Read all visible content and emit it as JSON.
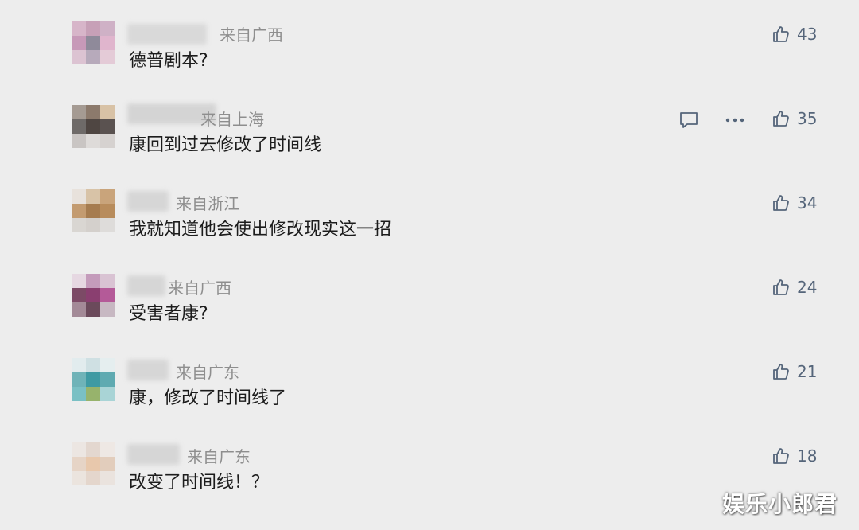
{
  "comments": [
    {
      "location": "来自广西",
      "text": "德普剧本?",
      "likes": "43"
    },
    {
      "location": "来自上海",
      "text": "康回到过去修改了时间线",
      "likes": "35"
    },
    {
      "location": "来自浙江",
      "text": "我就知道他会使出修改现实这一招",
      "likes": "34"
    },
    {
      "location": "来自广西",
      "text": "受害者康?",
      "likes": "24"
    },
    {
      "location": "来自广东",
      "text": "康，修改了时间线了",
      "likes": "21"
    },
    {
      "location": "来自广东",
      "text": "改变了时间线！？",
      "likes": "18"
    }
  ],
  "icons": {
    "like": "thumbs-up-icon",
    "reply": "comment-icon",
    "more": "more-dots-icon"
  },
  "colors": {
    "background": "#ededed",
    "icon": "#55657a",
    "location_text": "#8e8e8e",
    "content_text": "#1c1c1c"
  },
  "watermark": "娱乐小郎君"
}
